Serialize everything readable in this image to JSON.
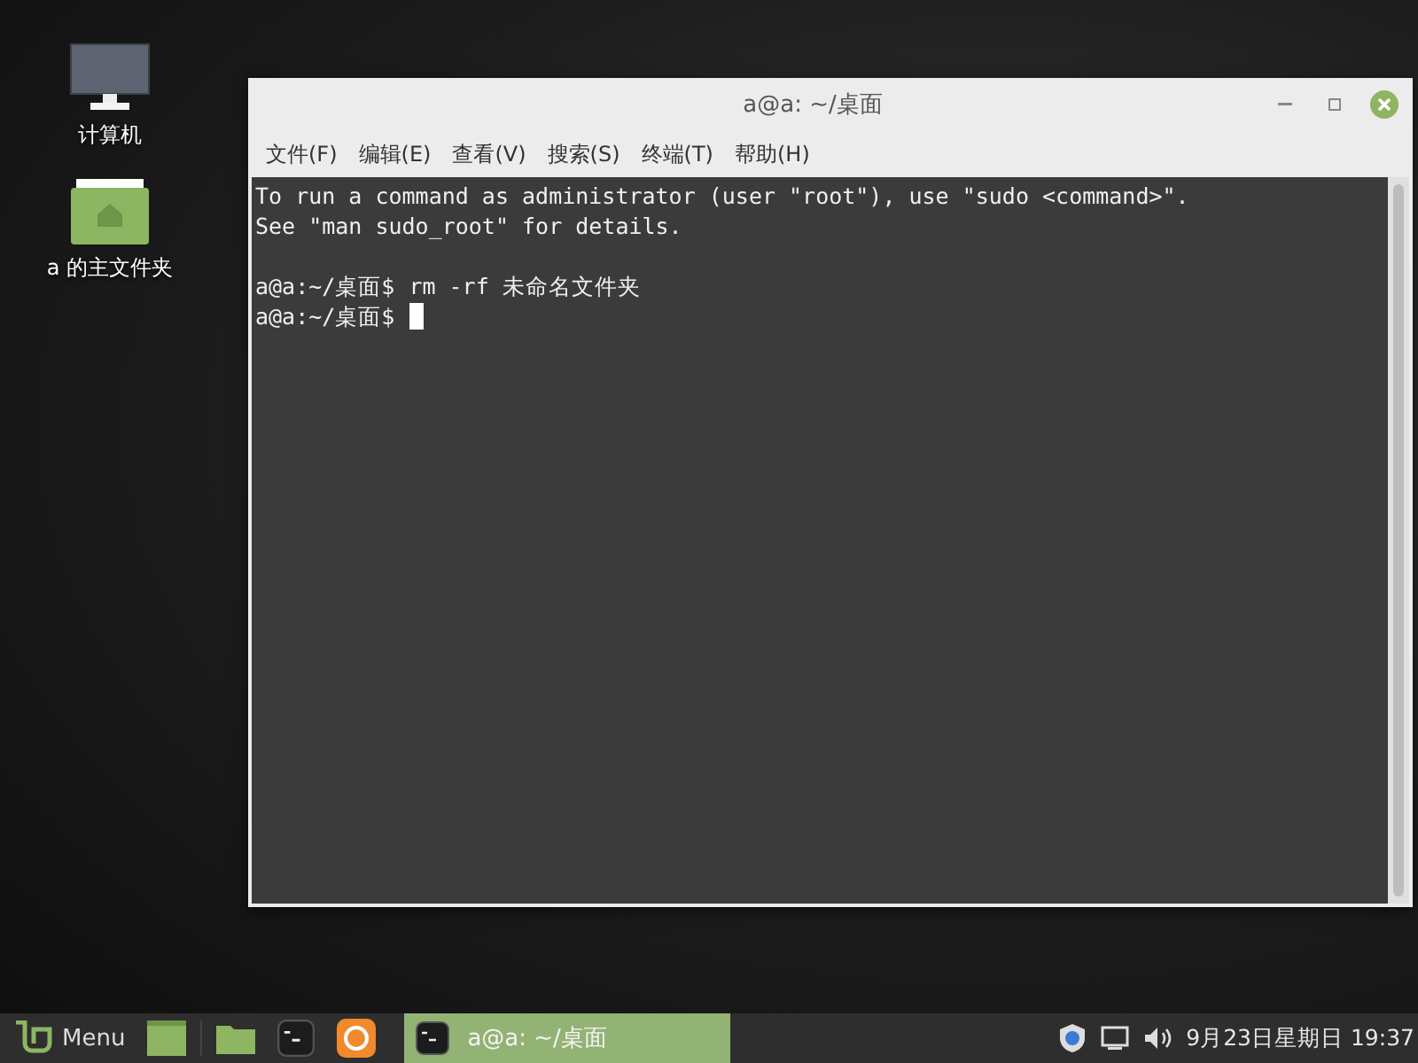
{
  "desktop_icons": [
    {
      "kind": "computer",
      "label": "计算机"
    },
    {
      "kind": "home",
      "label": "a 的主文件夹"
    }
  ],
  "window": {
    "title": "a@a: ~/桌面",
    "menu": [
      "文件(F)",
      "编辑(E)",
      "查看(V)",
      "搜索(S)",
      "终端(T)",
      "帮助(H)"
    ],
    "terminal_lines": [
      {
        "kind": "text",
        "text": "To run a command as administrator (user \"root\"), use \"sudo <command>\"."
      },
      {
        "kind": "text",
        "text": "See \"man sudo_root\" for details."
      },
      {
        "kind": "blank"
      },
      {
        "kind": "prompt",
        "prompt": "a@a:~/桌面$",
        "command": "rm -rf 未命名文件夹",
        "cursor": false
      },
      {
        "kind": "prompt",
        "prompt": "a@a:~/桌面$",
        "cursor": true
      }
    ]
  },
  "taskbar": {
    "menu_label": "Menu",
    "launchers": [
      {
        "kind": "desktop"
      },
      {
        "kind": "folder"
      },
      {
        "kind": "terminal"
      },
      {
        "kind": "browser"
      }
    ],
    "windows": [
      {
        "title": "a@a: ~/桌面",
        "selected": true
      }
    ],
    "clock": "9月23日星期日 19:37"
  }
}
